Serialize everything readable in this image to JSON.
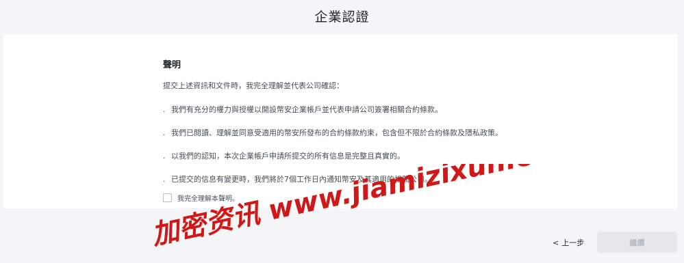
{
  "header": {
    "title": "企業認證"
  },
  "declaration": {
    "heading": "聲明",
    "intro": "提交上述資訊和文件時，我完全理解並代表公司確認：",
    "bullet_symbol": ".",
    "clauses": [
      "我們有充分的權力與授權以開設幣安企業帳戶並代表申請公司簽署相關合約條款。",
      "我們已閱讀、理解並同意受適用的幣安所發布的合約條款約束，包含但不限於合約條款及隱私政策。",
      "以我們的認知，本次企業帳戶申請所提交的所有信息是完整且真實的。",
      "已提交的信息有變更時，我們將於7個工作日內通知幣安及其適用的相關公司。"
    ],
    "agree_label": "我完全理解本聲明。",
    "agree_checked": false
  },
  "footer": {
    "back_label": "上一步",
    "back_icon": "chevron-left-icon",
    "continue_label": "繼續",
    "continue_enabled": false
  },
  "watermark": {
    "text": "加密资讯 www.jiamizixun.com",
    "color": "#d01818"
  }
}
